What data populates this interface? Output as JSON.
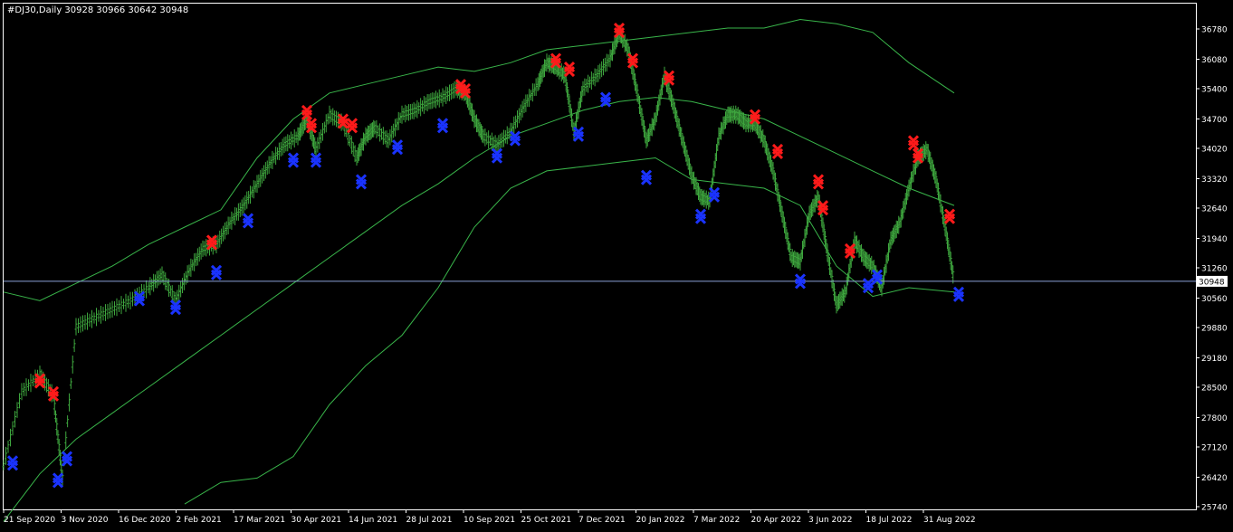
{
  "chart_data": {
    "type": "line",
    "title": "#DJ30,Daily  30928 30966 30642 30948",
    "xlabel": "",
    "ylabel": "",
    "ylim": [
      25740,
      37200
    ],
    "y_ticks": [
      36780,
      36080,
      35400,
      34700,
      34020,
      33320,
      32640,
      31940,
      31260,
      30560,
      29880,
      29180,
      28500,
      27800,
      27120,
      26420,
      25740
    ],
    "x_ticks": [
      "21 Sep 2020",
      "3 Nov 2020",
      "16 Dec 2020",
      "2 Feb 2021",
      "17 Mar 2021",
      "30 Apr 2021",
      "14 Jun 2021",
      "28 Jul 2021",
      "10 Sep 2021",
      "25 Oct 2021",
      "7 Dec 2021",
      "20 Jan 2022",
      "7 Mar 2022",
      "20 Apr 2022",
      "3 Jun 2022",
      "18 Jul 2022",
      "31 Aug 2022"
    ],
    "current_price": 30948,
    "current_price_label": "30948",
    "colors": {
      "background": "#000000",
      "price": "#3ea63e",
      "bands": "#39b54a",
      "current_line": "#8a9fd6",
      "sell_marker": "#ff1a1a",
      "buy_marker": "#1a33ff",
      "text": "#ffffff"
    },
    "series": [
      {
        "x": [
          0,
          20,
          40,
          55,
          65,
          80,
          100,
          120,
          140,
          160,
          175,
          190,
          205,
          220,
          235,
          250,
          265,
          280,
          295,
          310,
          325,
          335,
          345,
          360,
          375,
          390,
          400,
          410,
          425,
          440,
          455,
          470,
          485,
          500,
          510,
          520,
          530,
          545,
          560,
          575,
          590,
          600,
          610,
          620,
          630,
          640,
          655,
          670,
          680,
          690,
          700,
          710,
          720,
          730,
          740,
          750,
          760,
          770,
          780,
          790,
          800,
          810,
          820,
          830,
          840,
          850,
          860,
          870,
          880,
          890,
          900,
          910,
          920,
          930,
          940,
          950,
          960,
          970,
          980,
          990,
          1000,
          1010,
          1020,
          1030,
          1040,
          1050
        ],
        "values": [
          26700,
          28400,
          28800,
          28300,
          26400,
          29900,
          30100,
          30300,
          30500,
          30800,
          31100,
          30500,
          31200,
          31700,
          31800,
          32300,
          32700,
          33200,
          33700,
          34100,
          34300,
          34700,
          34000,
          34800,
          34600,
          33800,
          34300,
          34500,
          34200,
          34800,
          34900,
          35100,
          35200,
          35400,
          35300,
          34700,
          34300,
          34100,
          34400,
          35000,
          35500,
          36000,
          35900,
          35700,
          34400,
          35400,
          35700,
          36100,
          36700,
          36300,
          35300,
          34200,
          34700,
          35700,
          35000,
          34200,
          33400,
          32900,
          32800,
          34300,
          34800,
          34800,
          34600,
          34600,
          34200,
          33500,
          32500,
          31500,
          31400,
          32500,
          32900,
          31600,
          30400,
          30700,
          31900,
          31500,
          31300,
          30800,
          31900,
          32300,
          33100,
          33800,
          34000,
          33300,
          32200,
          30948
        ]
      },
      {
        "x": [
          0,
          40,
          80,
          120,
          160,
          200,
          240,
          280,
          320,
          360,
          400,
          440,
          480,
          520,
          560,
          600,
          640,
          680,
          720,
          760,
          800,
          840,
          880,
          920,
          960,
          1000,
          1050
        ],
        "values": [
          25400,
          26500,
          27300,
          27900,
          28500,
          29100,
          29700,
          30300,
          30900,
          31500,
          32100,
          32700,
          33200,
          33800,
          34300,
          34600,
          34900,
          35100,
          35200,
          35100,
          34900,
          34700,
          34300,
          33900,
          33500,
          33100,
          32700
        ]
      },
      {
        "x": [
          0,
          40,
          80,
          120,
          160,
          200,
          240,
          280,
          320,
          360,
          400,
          440,
          480,
          520,
          560,
          600,
          640,
          680,
          720,
          760,
          800,
          840,
          880,
          920,
          960,
          1000,
          1050
        ],
        "values": [
          30700,
          30500,
          30900,
          31300,
          31800,
          32200,
          32600,
          33800,
          34700,
          35300,
          35500,
          35700,
          35900,
          35800,
          36000,
          36300,
          36400,
          36500,
          36600,
          36700,
          36800,
          36800,
          37000,
          36900,
          36700,
          36000,
          35300
        ]
      },
      {
        "x": [
          200,
          240,
          280,
          320,
          360,
          400,
          440,
          480,
          520,
          560,
          600,
          640,
          680,
          720,
          760,
          800,
          840,
          880,
          920,
          960,
          1000,
          1050
        ],
        "values": [
          25800,
          26300,
          26400,
          26900,
          28100,
          29000,
          29700,
          30800,
          32200,
          33100,
          33500,
          33600,
          33700,
          33800,
          33300,
          33200,
          33100,
          32700,
          31300,
          30600,
          30800,
          30700
        ]
      }
    ],
    "markers": {
      "sell": [
        [
          40,
          28700
        ],
        [
          55,
          28400
        ],
        [
          230,
          31900
        ],
        [
          335,
          34900
        ],
        [
          340,
          34600
        ],
        [
          375,
          34700
        ],
        [
          385,
          34600
        ],
        [
          505,
          35500
        ],
        [
          510,
          35400
        ],
        [
          610,
          36100
        ],
        [
          625,
          35900
        ],
        [
          680,
          36800
        ],
        [
          695,
          36100
        ],
        [
          735,
          35700
        ],
        [
          830,
          34800
        ],
        [
          855,
          34000
        ],
        [
          900,
          33300
        ],
        [
          905,
          32700
        ],
        [
          935,
          31700
        ],
        [
          1005,
          34200
        ],
        [
          1010,
          33900
        ],
        [
          1045,
          32500
        ]
      ],
      "buy": [
        [
          10,
          26800
        ],
        [
          60,
          26400
        ],
        [
          70,
          26900
        ],
        [
          150,
          30600
        ],
        [
          190,
          30400
        ],
        [
          235,
          31200
        ],
        [
          270,
          32400
        ],
        [
          320,
          33800
        ],
        [
          345,
          33800
        ],
        [
          395,
          33300
        ],
        [
          435,
          34100
        ],
        [
          485,
          34600
        ],
        [
          545,
          33900
        ],
        [
          565,
          34300
        ],
        [
          635,
          34400
        ],
        [
          665,
          35200
        ],
        [
          710,
          33400
        ],
        [
          770,
          32500
        ],
        [
          785,
          33000
        ],
        [
          880,
          31000
        ],
        [
          955,
          30900
        ],
        [
          965,
          31100
        ],
        [
          1055,
          30700
        ]
      ]
    }
  }
}
